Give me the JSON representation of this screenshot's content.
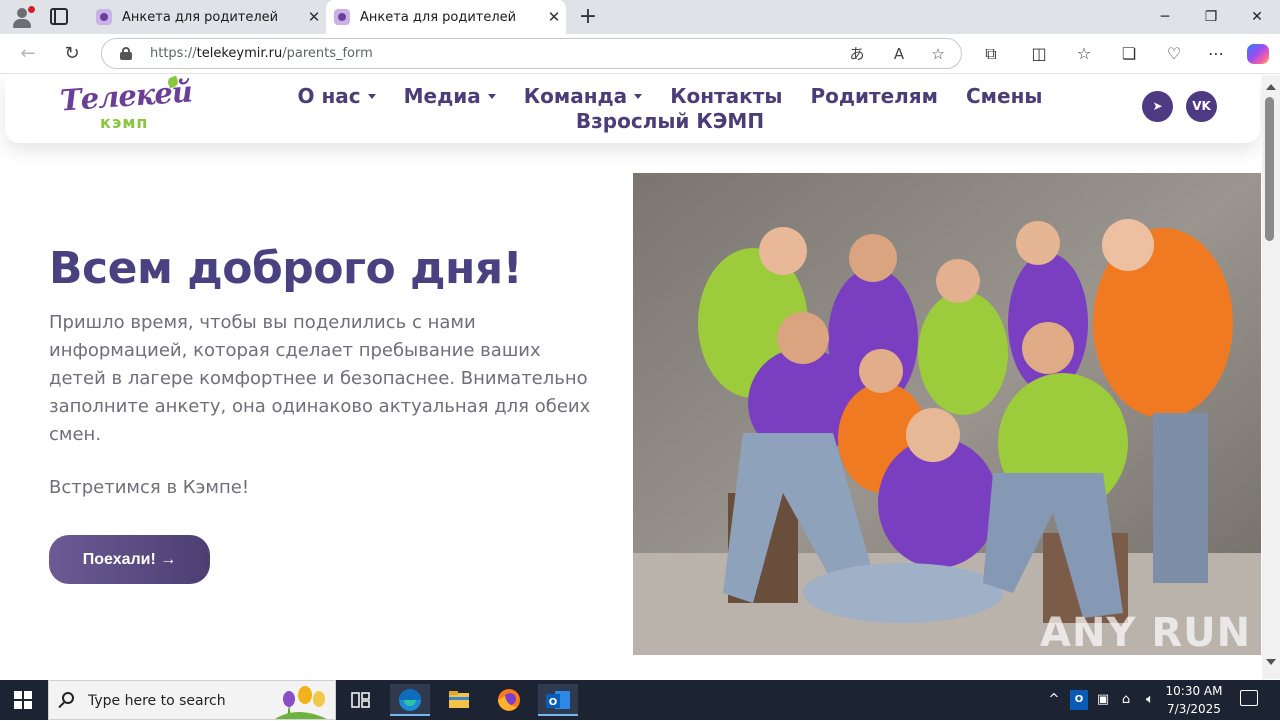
{
  "browser": {
    "tabs": [
      {
        "title": "Анкета для родителей",
        "active": false
      },
      {
        "title": "Анкета для родителей",
        "active": true
      }
    ],
    "url_prefix": "https://",
    "url_domain": "telekeymir.ru",
    "url_path": "/parents_form",
    "window_controls": {
      "minimize": "─",
      "restore": "❐",
      "close": "✕"
    }
  },
  "site": {
    "logo": {
      "line1": "Телекей",
      "line2": "кэмп"
    },
    "menu": {
      "row1": [
        "О нас",
        "Медиа",
        "Команда",
        "Контакты",
        "Родителям",
        "Смены"
      ],
      "row2": [
        "Взрослый КЭМП"
      ],
      "dropdowns": [
        "О нас",
        "Медиа",
        "Команда"
      ]
    },
    "social": {
      "telegram": "➤",
      "vk": "VK"
    },
    "hero": {
      "title": "Всем доброго дня!",
      "text": "Пришло время, чтобы вы поделились с нами информацией, которая сделает пребывание ваших детей в лагере комфортнее и безопаснее. Внимательно заполните анкету, она одинаково актуальная для обеих смен.",
      "subtext": "Встретимся в Кэмпе!",
      "cta_label": "Поехали! →"
    },
    "colors": {
      "brand_purple": "#4a3d78",
      "brand_green": "#8cc63f",
      "photo_orange": "#f07a22",
      "photo_lime": "#9ccc3c",
      "photo_violet": "#7a3fc0"
    }
  },
  "watermark": "ANY RUN",
  "taskbar": {
    "search_placeholder": "Type here to search",
    "time": "10:30 AM",
    "date": "7/3/2025"
  }
}
